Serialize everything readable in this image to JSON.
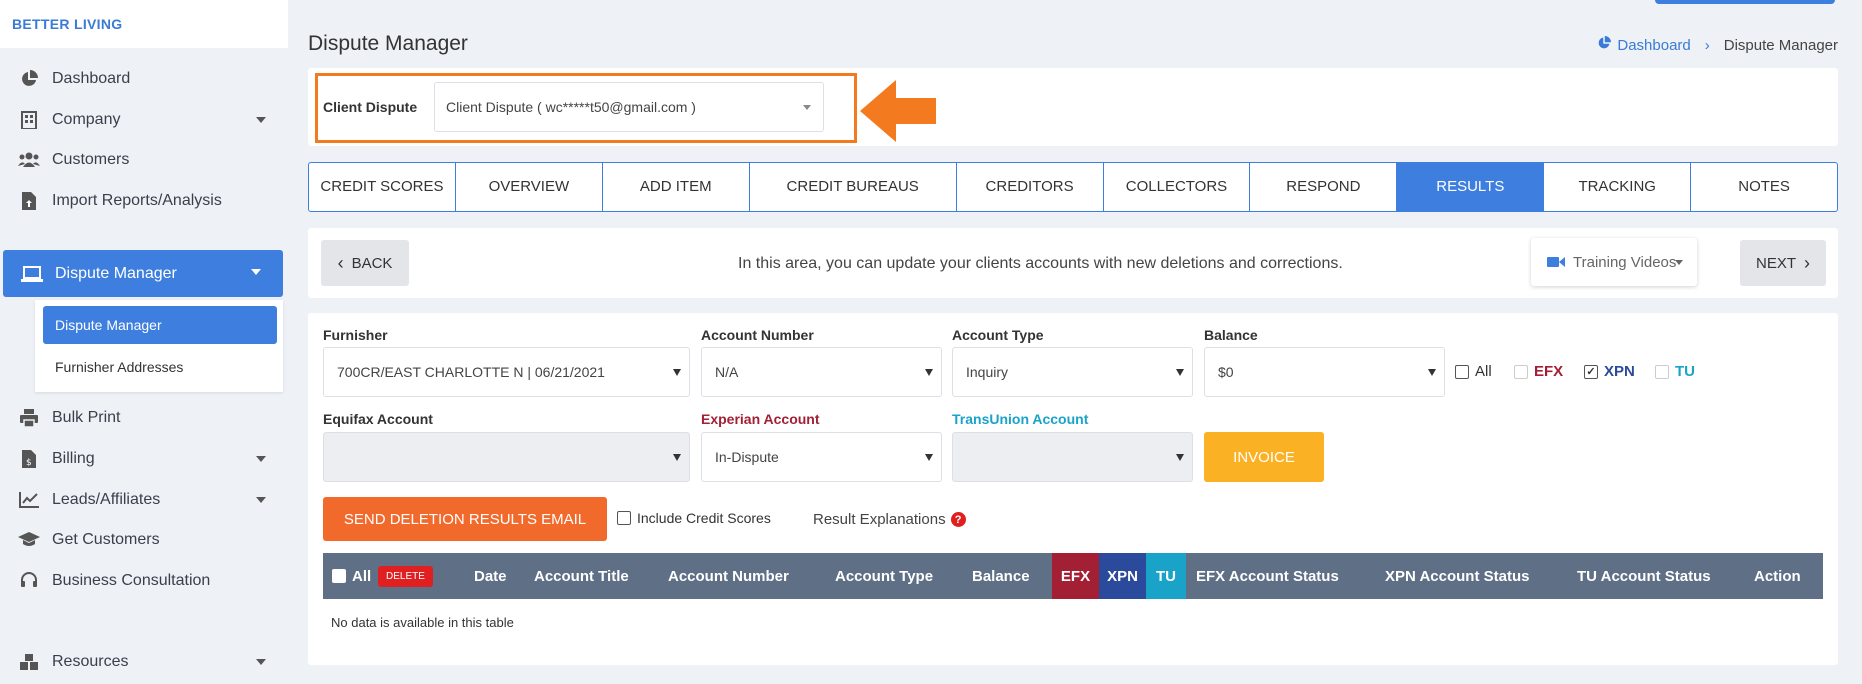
{
  "brand": "BETTER LIVING",
  "sidebar": {
    "items": [
      {
        "label": "Dashboard",
        "icon": "pie-chart-icon"
      },
      {
        "label": "Company",
        "icon": "building-icon"
      },
      {
        "label": "Customers",
        "icon": "users-icon"
      },
      {
        "label": "Import Reports/Analysis",
        "icon": "file-upload-icon"
      },
      {
        "label": "Dispute Manager",
        "icon": "laptop-icon"
      },
      {
        "label": "Bulk Print",
        "icon": "print-icon"
      },
      {
        "label": "Billing",
        "icon": "invoice-icon"
      },
      {
        "label": "Leads/Affiliates",
        "icon": "line-chart-icon"
      },
      {
        "label": "Get Customers",
        "icon": "graduation-cap-icon"
      },
      {
        "label": "Business Consultation",
        "icon": "headset-icon"
      },
      {
        "label": "Resources",
        "icon": "boxes-icon"
      }
    ],
    "submenu": [
      "Dispute Manager",
      "Furnisher Addresses"
    ]
  },
  "header": {
    "title": "Dispute Manager",
    "breadcrumb": [
      "Dashboard",
      "Dispute Manager"
    ]
  },
  "client_dispute": {
    "label": "Client Dispute",
    "value": "Client Dispute ( wc*****t50@gmail.com )"
  },
  "tabs": [
    {
      "label": "CREDIT SCORES"
    },
    {
      "label": "OVERVIEW"
    },
    {
      "label": "ADD ITEM"
    },
    {
      "label": "CREDIT BUREAUS"
    },
    {
      "label": "CREDITORS"
    },
    {
      "label": "COLLECTORS"
    },
    {
      "label": "RESPOND"
    },
    {
      "label": "RESULTS"
    },
    {
      "label": "TRACKING"
    },
    {
      "label": "NOTES"
    }
  ],
  "active_tab": "RESULTS",
  "info_bar": {
    "back": "BACK",
    "text": "In this area, you can update your clients accounts with new deletions and corrections.",
    "training": "Training Videos",
    "next": "NEXT"
  },
  "form": {
    "furnisher": {
      "label": "Furnisher",
      "value": "700CR/EAST CHARLOTTE N | 06/21/2021"
    },
    "account_number": {
      "label": "Account Number",
      "value": "N/A"
    },
    "account_type": {
      "label": "Account Type",
      "value": "Inquiry"
    },
    "balance": {
      "label": "Balance",
      "value": "$0"
    },
    "bureaus": {
      "all": "All",
      "efx": "EFX",
      "xpn": "XPN",
      "tu": "TU"
    },
    "equifax_account": {
      "label": "Equifax Account",
      "value": ""
    },
    "experian_account": {
      "label": "Experian Account",
      "value": "In-Dispute"
    },
    "transunion_account": {
      "label": "TransUnion Account",
      "value": ""
    },
    "invoice": "INVOICE",
    "send_email": "SEND DELETION RESULTS EMAIL",
    "include_scores": "Include Credit Scores",
    "result_explanations": "Result Explanations"
  },
  "table": {
    "all": "All",
    "delete": "DELETE",
    "columns": [
      "Date",
      "Account Title",
      "Account Number",
      "Account Type",
      "Balance",
      "EFX",
      "XPN",
      "TU",
      "EFX Account Status",
      "XPN Account Status",
      "TU Account Status",
      "Action"
    ],
    "empty": "No data is available in this table"
  },
  "colors": {
    "accent": "#3d7ede",
    "highlight": "#f47a20",
    "efx": "#a31f34",
    "xpn": "#2b4a9b",
    "tu": "#1aa3c9",
    "invoice": "#fbb124",
    "send": "#f26a2b",
    "table_header": "#5f6f86"
  }
}
